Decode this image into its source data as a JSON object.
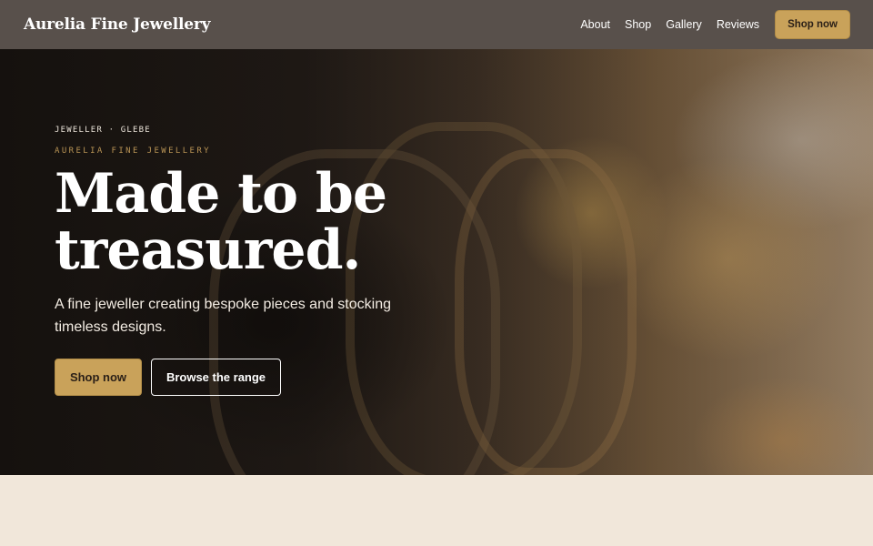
{
  "header": {
    "brand": "Aurelia Fine Jewellery",
    "nav": [
      "About",
      "Shop",
      "Gallery",
      "Reviews"
    ],
    "cta": "Shop now"
  },
  "hero": {
    "eyebrow": "JEWELLER · GLEBE",
    "subeyebrow": "AURELIA FINE JEWELLERY",
    "headline_line1": "Made to be",
    "headline_line2": "treasured.",
    "lead": "A fine jeweller creating bespoke pieces and stocking timeless designs.",
    "primary_cta": "Shop now",
    "secondary_cta": "Browse the range"
  },
  "colors": {
    "header_bg": "#58504b",
    "accent": "#c9a25a",
    "section_bg": "#f1e7da"
  }
}
